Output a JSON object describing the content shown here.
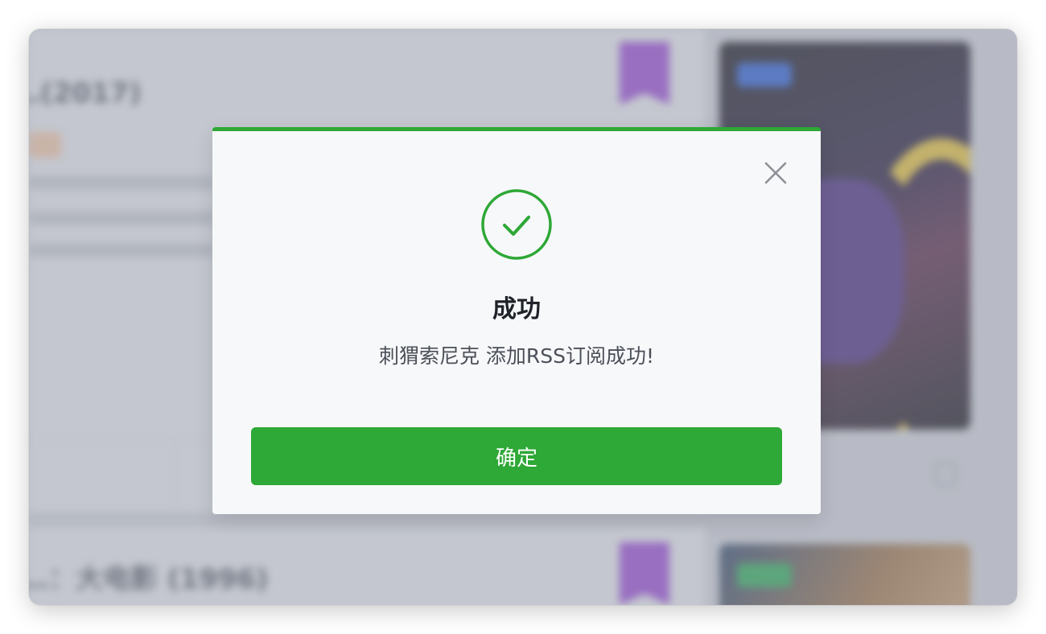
{
  "background": {
    "card_title": "…(2017)",
    "card_bottom_title": "…：大电影 (1996)"
  },
  "dialog": {
    "title": "成功",
    "message": "刺猬索尼克 添加RSS订阅成功!",
    "confirm_label": "确定",
    "close_icon": "close-icon",
    "status_icon": "check-circle-icon",
    "accent_color": "#2ea836"
  }
}
